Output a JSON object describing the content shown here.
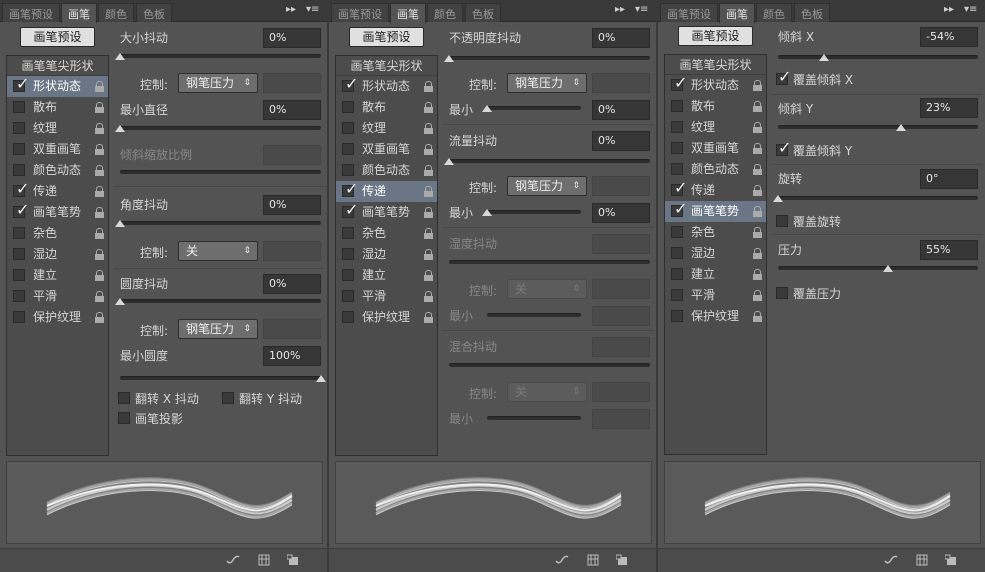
{
  "tabs": [
    "画笔预设",
    "画笔",
    "颜色",
    "色板"
  ],
  "active_tab": "画笔",
  "tab_controls": {
    "expand": "▸▸",
    "menu": "▾≡"
  },
  "preset_button": "画笔预设",
  "sidebar_header": "画笔笔尖形状",
  "sidebar_items": [
    "形状动态",
    "散布",
    "纹理",
    "双重画笔",
    "颜色动态",
    "传递",
    "画笔笔势",
    "杂色",
    "湿边",
    "建立",
    "平滑",
    "保护纹理"
  ],
  "sidebar_checked": [
    "形状动态",
    "传递",
    "画笔笔势"
  ],
  "panel1": {
    "selected": "形状动态",
    "size_jitter": {
      "label": "大小抖动",
      "value": "0%"
    },
    "control_label": "控制:",
    "control1": "钢笔压力",
    "min_diameter": {
      "label": "最小直径",
      "value": "0%"
    },
    "tilt_scale": {
      "label": "倾斜缩放比例"
    },
    "angle_jitter": {
      "label": "角度抖动",
      "value": "0%"
    },
    "control2": "关",
    "roundness_jitter": {
      "label": "圆度抖动",
      "value": "0%"
    },
    "control3": "钢笔压力",
    "min_roundness": {
      "label": "最小圆度",
      "value": "100%"
    },
    "flip_x": "翻转 X 抖动",
    "flip_y": "翻转 Y 抖动",
    "projection": "画笔投影"
  },
  "panel2": {
    "selected": "传递",
    "opacity_jitter": {
      "label": "不透明度抖动",
      "value": "0%"
    },
    "control_label": "控制:",
    "control1": "钢笔压力",
    "min_label": "最小",
    "min1": "0%",
    "flow_jitter": {
      "label": "流量抖动",
      "value": "0%"
    },
    "control2": "钢笔压力",
    "min2": "0%",
    "wetness_jitter": {
      "label": "湿度抖动"
    },
    "control3": "关",
    "mix_jitter": {
      "label": "混合抖动"
    },
    "control4": "关"
  },
  "panel3": {
    "selected": "画笔笔势",
    "tilt_x": {
      "label": "倾斜 X",
      "value": "-54%"
    },
    "override_tilt_x": "覆盖倾斜 X",
    "tilt_y": {
      "label": "倾斜 Y",
      "value": "23%"
    },
    "override_tilt_y": "覆盖倾斜 Y",
    "rotation": {
      "label": "旋转",
      "value": "0°"
    },
    "override_rotation": "覆盖旋转",
    "pressure": {
      "label": "压力",
      "value": "55%"
    },
    "override_pressure": "覆盖压力"
  },
  "slider_levels": {
    "tilt_x": -0.54,
    "tilt_y": 0.23,
    "rotation": 0,
    "pressure": 0.55,
    "min_roundness": 1.0
  },
  "bottom_icons": [
    "brush-toggle-icon",
    "grid-panel-icon",
    "new-preset-icon"
  ]
}
